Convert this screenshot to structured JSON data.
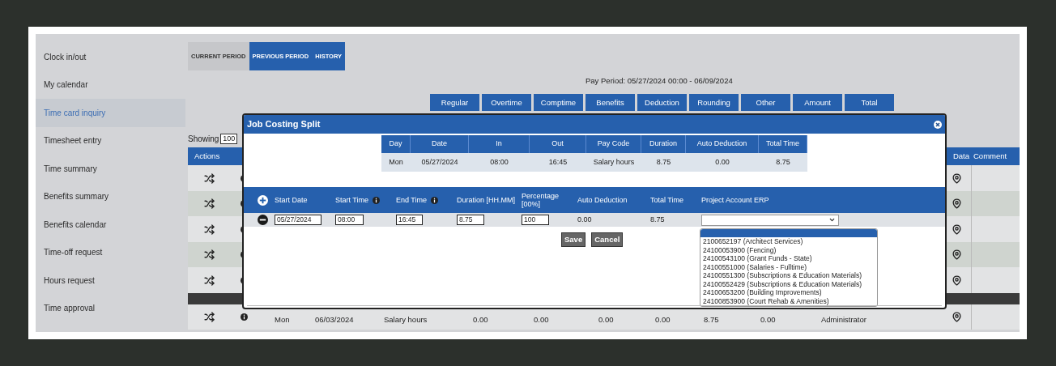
{
  "sidebar": {
    "items": [
      {
        "label": "Clock in/out",
        "selected": false
      },
      {
        "label": "My calendar",
        "selected": false
      },
      {
        "label": "Time card inquiry",
        "selected": true
      },
      {
        "label": "Timesheet entry",
        "selected": false
      },
      {
        "label": "Time summary",
        "selected": false
      },
      {
        "label": "Benefits summary",
        "selected": false
      },
      {
        "label": "Benefits calendar",
        "selected": false
      },
      {
        "label": "Time-off request",
        "selected": false
      },
      {
        "label": "Hours request",
        "selected": false
      },
      {
        "label": "Time approval",
        "selected": false
      }
    ]
  },
  "period_tabs": [
    {
      "label": "CURRENT PERIOD",
      "selected": true
    },
    {
      "label": "PREVIOUS PERIOD",
      "selected": false
    },
    {
      "label": "HISTORY",
      "selected": false
    }
  ],
  "pay_period": "Pay Period: 05/27/2024 00:00 - 06/09/2024",
  "summary_tabs": [
    "Regular",
    "Overtime",
    "Comptime",
    "Benefits",
    "Deduction",
    "Rounding",
    "Other",
    "Amount",
    "Total"
  ],
  "showing": {
    "label": "Showing",
    "value": "100"
  },
  "table": {
    "columns": [
      "Actions",
      "Data",
      "Comment"
    ],
    "rows": [
      {
        "kind": "entry"
      },
      {
        "kind": "entry"
      },
      {
        "kind": "entry"
      },
      {
        "kind": "entry"
      },
      {
        "kind": "entry"
      },
      {
        "kind": "divider"
      },
      {
        "kind": "entry",
        "cells": [
          "Mon",
          "06/03/2024",
          "Salary hours",
          "0.00",
          "0.00",
          "0.00",
          "0.00",
          "8.75",
          "0.00",
          "Administrator"
        ]
      }
    ]
  },
  "dialog": {
    "title": "Job Costing Split",
    "summary": {
      "columns": [
        "Day",
        "Date",
        "In",
        "Out",
        "Pay Code",
        "Duration",
        "Auto Deduction",
        "Total Time"
      ],
      "row": [
        "Mon",
        "05/27/2024",
        "08:00",
        "16:45",
        "Salary hours",
        "8.75",
        "0.00",
        "8.75"
      ]
    },
    "split": {
      "columns": [
        {
          "label": "Start Date"
        },
        {
          "label": "Start Time",
          "info": true
        },
        {
          "label": "End Time",
          "info": true
        },
        {
          "label": "Duration [HH.MM]"
        },
        {
          "label": "Percentage [00%]"
        },
        {
          "label": "Auto Deduction"
        },
        {
          "label": "Total Time"
        },
        {
          "label": "Project Account ERP"
        }
      ],
      "row": {
        "start_date": "05/27/2024",
        "start_time": "08:00",
        "end_time": "16:45",
        "duration": "8.75",
        "percentage": "100",
        "auto_deduction": "0.00",
        "total_time": "8.75"
      }
    },
    "buttons": [
      "Save",
      "Cancel"
    ],
    "dropdown": {
      "blank_highlighted": true,
      "options": [
        "2100652197 (Architect Services)",
        "24100053900 (Fencing)",
        "24100543100 (Grant Funds - State)",
        "24100551000 (Salaries - Fulltime)",
        "24100551300 (Subscriptions & Education Materials)",
        "24100552429 (Subscriptions & Education Materials)",
        "24100653200 (Building Improvements)",
        "24100853900 (Court Rehab & Amenities)"
      ]
    }
  }
}
